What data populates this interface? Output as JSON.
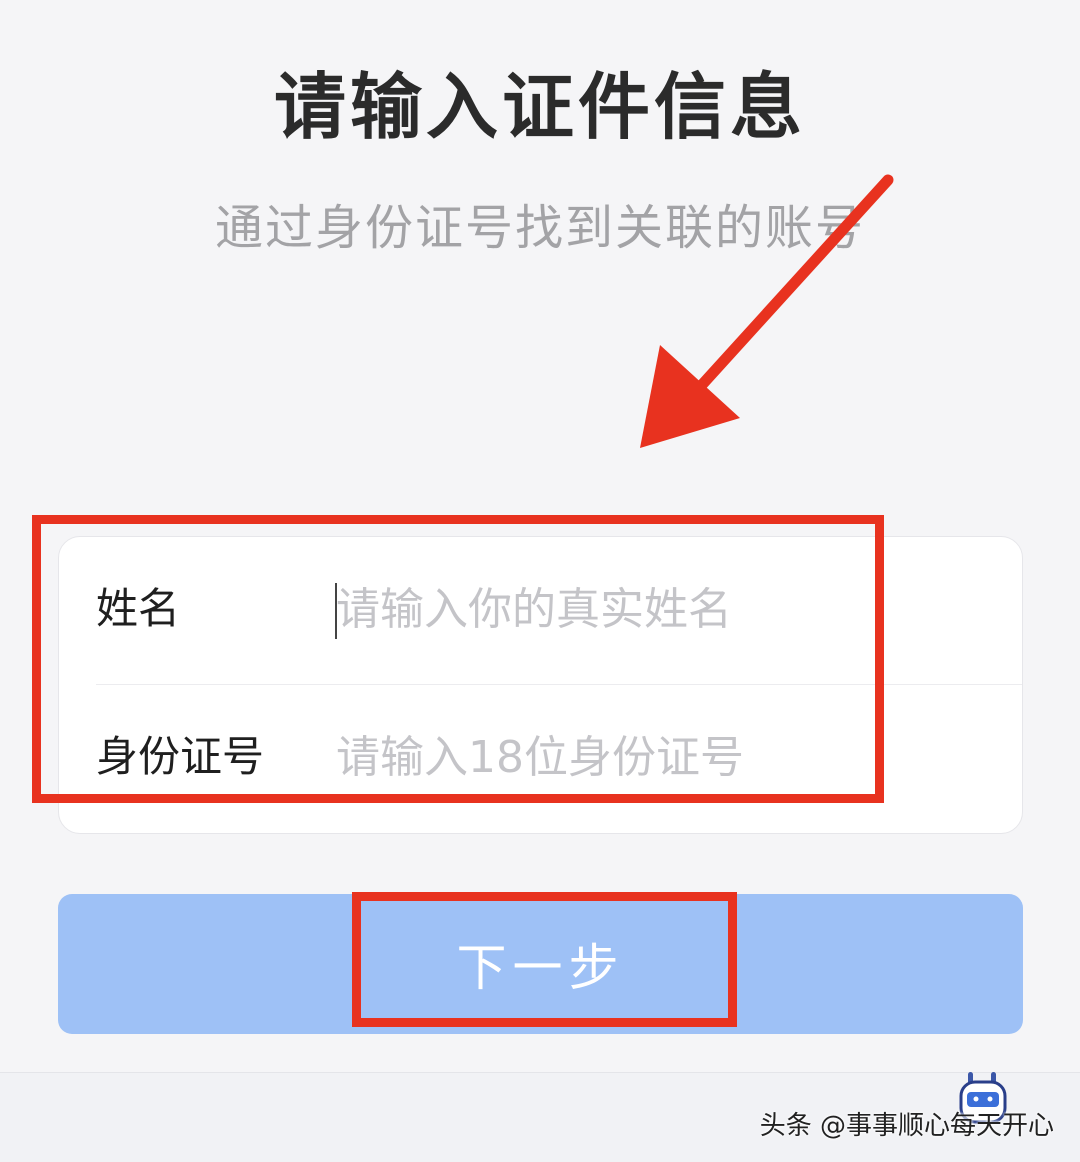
{
  "header": {
    "title": "请输入证件信息",
    "subtitle": "通过身份证号找到关联的账号"
  },
  "form": {
    "name_label": "姓名",
    "name_placeholder": "请输入你的真实姓名",
    "name_value": "",
    "id_label": "身份证号",
    "id_placeholder": "请输入18位身份证号",
    "id_value": ""
  },
  "actions": {
    "next_label": "下一步"
  },
  "annotations": {
    "highlight_color": "#e8321f",
    "arrow_icon": "red-arrow-icon"
  },
  "watermark": {
    "text": "头条 @事事顺心每天开心",
    "icon": "mascot-icon"
  },
  "colors": {
    "background": "#f5f5f7",
    "button": "#9ec1f6",
    "placeholder": "#c4c4c8"
  }
}
